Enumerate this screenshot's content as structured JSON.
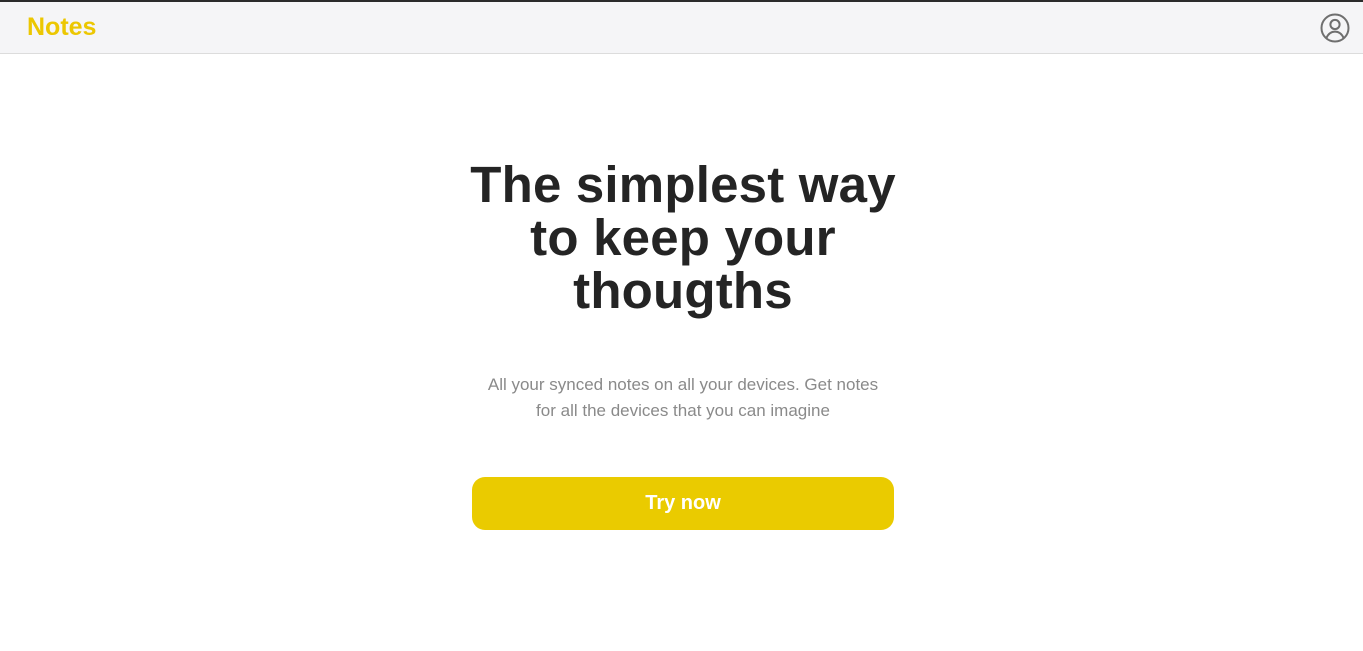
{
  "header": {
    "brand": "Notes",
    "user_icon": "user-circle-icon"
  },
  "hero": {
    "headline_lines": [
      "The simplest way",
      "to keep your",
      "thougths"
    ],
    "subtext_lines": [
      "All your synced notes on all your devices. Get notes",
      "for all the devices that you can imagine"
    ],
    "cta_label": "Try now"
  },
  "colors": {
    "accent": "#eacb00",
    "brand_text": "#ecc702",
    "header_bg": "#f5f5f7",
    "headline": "#242424",
    "subtext": "#8a8a8a"
  }
}
